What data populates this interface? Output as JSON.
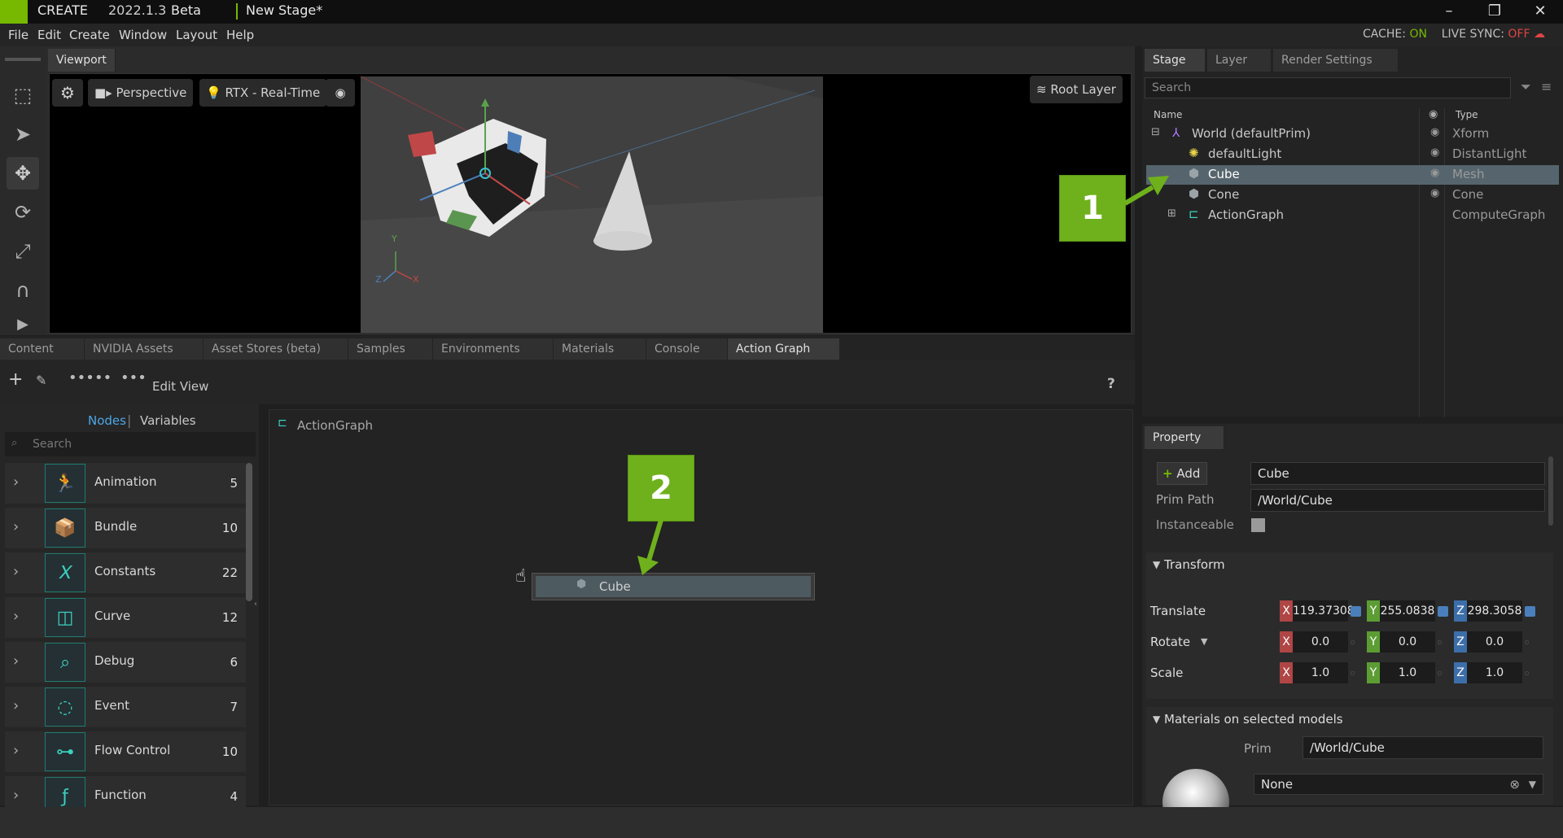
{
  "titlebar": {
    "app": "CREATE",
    "version": "2022.1.3",
    "beta": "Beta",
    "stage": "New Stage*"
  },
  "menu": {
    "items": [
      "File",
      "Edit",
      "Create",
      "Window",
      "Layout",
      "Help"
    ],
    "cache_label": "CACHE:",
    "cache_value": "ON",
    "sync_label": "LIVE SYNC:",
    "sync_value": "OFF"
  },
  "viewport": {
    "tab": "Viewport",
    "camera": "Perspective",
    "renderer": "RTX - Real-Time",
    "layer": "Root Layer"
  },
  "bottom_tabs": [
    "Content",
    "NVIDIA Assets",
    "Asset Stores (beta)",
    "Samples",
    "Environments",
    "Materials",
    "Console",
    "Action Graph"
  ],
  "action_graph": {
    "edit_view": "Edit View",
    "help": "?",
    "nodes_tab": "Nodes",
    "variables_tab": "Variables",
    "search_placeholder": "Search",
    "graph_name": "ActionGraph",
    "drag_node": "Cube"
  },
  "categories": [
    {
      "name": "Animation",
      "count": "5"
    },
    {
      "name": "Bundle",
      "count": "10"
    },
    {
      "name": "Constants",
      "count": "22"
    },
    {
      "name": "Curve",
      "count": "12"
    },
    {
      "name": "Debug",
      "count": "6"
    },
    {
      "name": "Event",
      "count": "7"
    },
    {
      "name": "Flow Control",
      "count": "10"
    },
    {
      "name": "Function",
      "count": "4"
    }
  ],
  "stage": {
    "tabs": [
      "Stage",
      "Layer",
      "Render Settings"
    ],
    "search_placeholder": "Search",
    "col_name": "Name",
    "col_type": "Type",
    "rows": [
      {
        "name": "World (defaultPrim)",
        "type": "Xform"
      },
      {
        "name": "defaultLight",
        "type": "DistantLight"
      },
      {
        "name": "Cube",
        "type": "Mesh"
      },
      {
        "name": "Cone",
        "type": "Cone"
      },
      {
        "name": "ActionGraph",
        "type": "ComputeGraph"
      }
    ]
  },
  "property": {
    "tab": "Property",
    "add_label": "Add",
    "name_value": "Cube",
    "prim_path_label": "Prim Path",
    "prim_path_value": "/World/Cube",
    "instanceable_label": "Instanceable",
    "transform_label": "Transform",
    "translate_label": "Translate",
    "rotate_label": "Rotate",
    "scale_label": "Scale",
    "translate": [
      "119.37308",
      "255.0838",
      "298.3058"
    ],
    "rotate": [
      "0.0",
      "0.0",
      "0.0"
    ],
    "scale": [
      "1.0",
      "1.0",
      "1.0"
    ],
    "materials_label": "Materials on selected models",
    "prim_label": "Prim",
    "prim_value": "/World/Cube",
    "material_value": "None"
  },
  "callouts": [
    "1",
    "2"
  ],
  "axis": {
    "x": "X",
    "y": "Y",
    "z": "Z"
  },
  "colors": {
    "accent": "#77b900",
    "selection": "#56656d",
    "teal": "#3bd1c0"
  }
}
